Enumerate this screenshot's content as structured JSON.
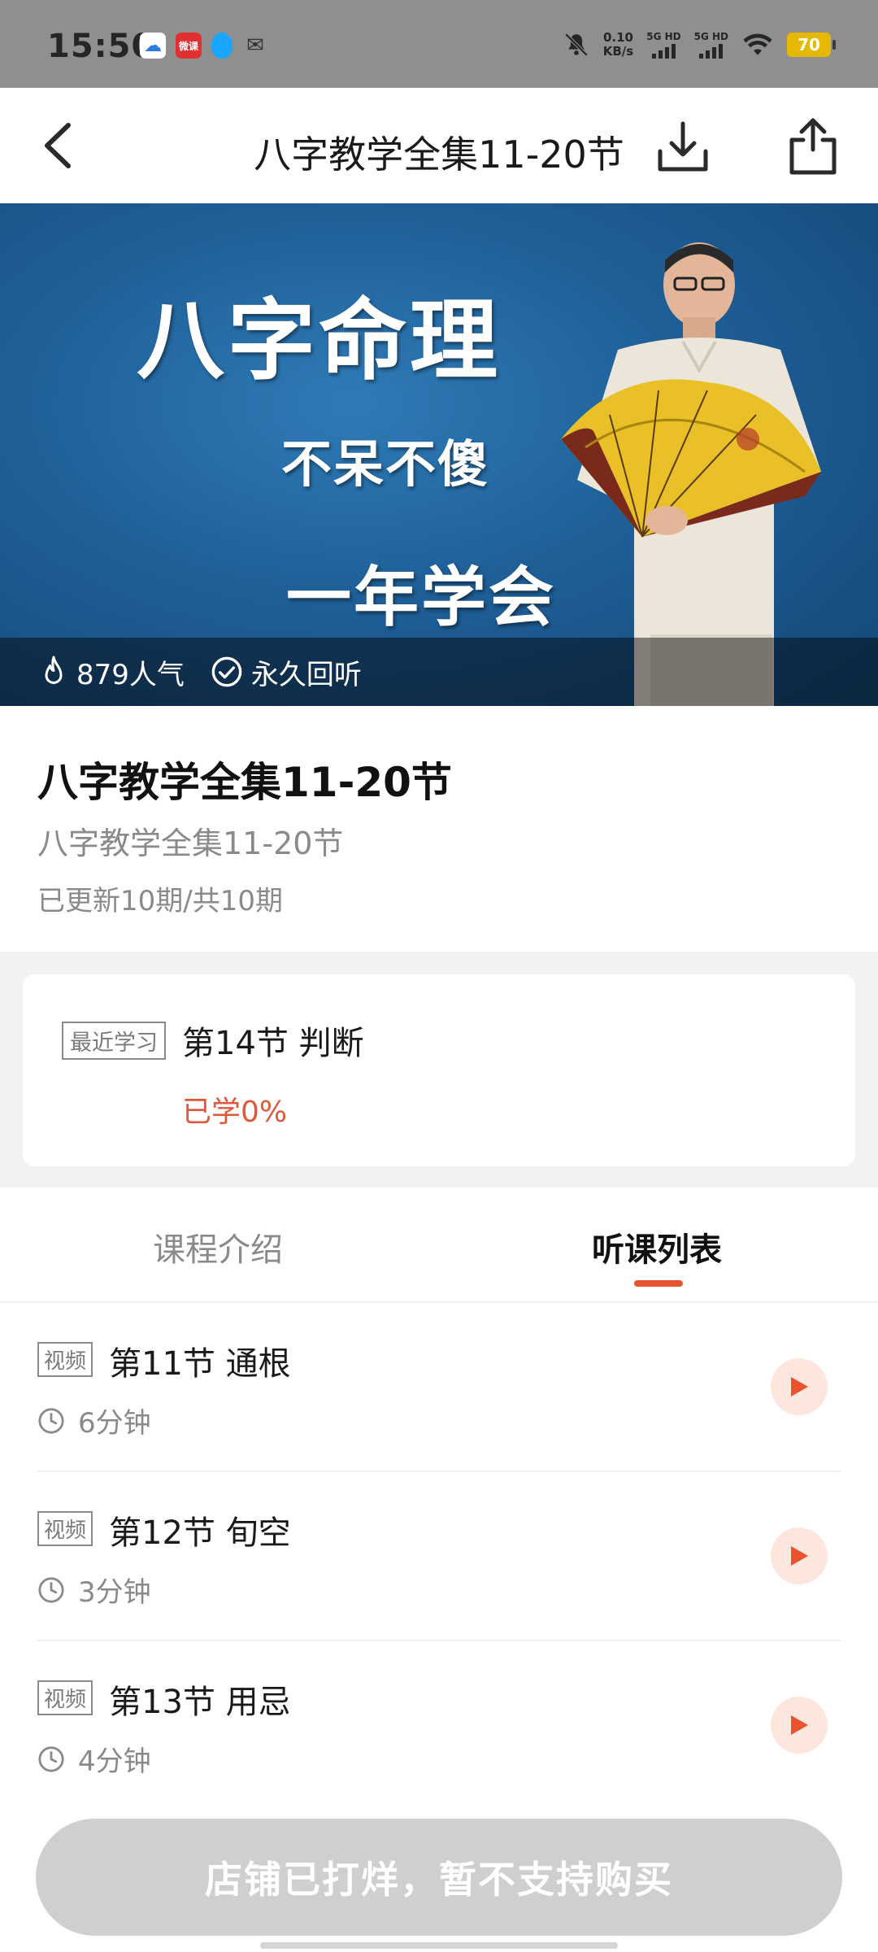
{
  "status_bar": {
    "time": "15:50",
    "app_icons": [
      "baidu-netdisk-icon",
      "wk-app-icon",
      "qq-icon",
      "wechat-icon"
    ],
    "wk_label": "微课",
    "net_speed_value": "0.10",
    "net_speed_unit": "KB/s",
    "sim1_label": "5G HD",
    "sim2_label": "5G HD",
    "battery": "70"
  },
  "nav": {
    "title": "八字教学全集11-20节"
  },
  "banner": {
    "line1": "八字命理",
    "line2": "不呆不傻",
    "line3": "一年学会",
    "popularity": "879人气",
    "replay": "永久回听"
  },
  "course": {
    "title": "八字教学全集11-20节",
    "subtitle": "八字教学全集11-20节",
    "updates": "已更新10期/共10期"
  },
  "recent": {
    "tag": "最近学习",
    "lesson": "第14节 判断",
    "progress": "已学0%"
  },
  "tabs": {
    "intro": "课程介绍",
    "list": "听课列表",
    "active": "list"
  },
  "lessons": [
    {
      "tag": "视频",
      "title": "第11节 通根",
      "duration": "6分钟"
    },
    {
      "tag": "视频",
      "title": "第12节 旬空",
      "duration": "3分钟"
    },
    {
      "tag": "视频",
      "title": "第13节 用忌",
      "duration": "4分钟"
    }
  ],
  "bottom": {
    "button_label": "店铺已打烊，暂不支持购买"
  },
  "colors": {
    "accent": "#e8532f",
    "progress_text": "#e0583a",
    "disabled_button": "#cfcfcf"
  }
}
